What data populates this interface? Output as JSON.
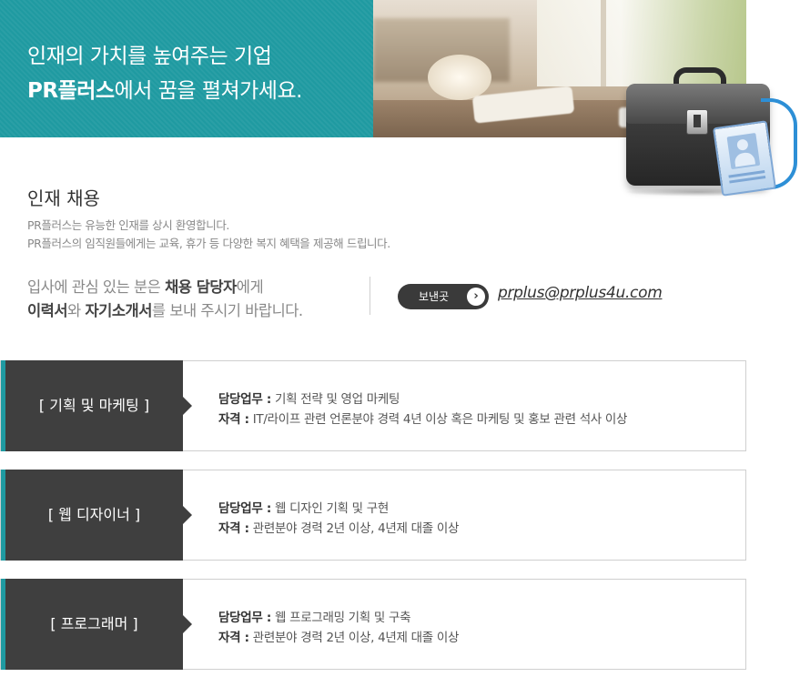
{
  "hero": {
    "line1": "인재의 가치를 높여주는 기업",
    "line2_brand": "PR플러스",
    "line2_rest": "에서 꿈을 펼쳐가세요."
  },
  "intro": {
    "title": "인재 채용",
    "desc1": "PR플러스는 유능한 인재를 상시 환영합니다.",
    "desc2": "PR플러스의 임직원들에게는 교육, 휴가 등 다양한 복지 혜택을 제공해 드립니다."
  },
  "apply": {
    "l1_pre": "입사에 관심 있는 분은 ",
    "l1_bold": "채용 담당자",
    "l1_post": "에게",
    "l2_bold1": "이력서",
    "l2_mid": "와 ",
    "l2_bold2": "자기소개서",
    "l2_post": "를 보내 주시기 바랍니다.",
    "send_label": "보낸곳",
    "send_icon": "chevron-right-icon",
    "email": "prplus@prplus4u.com"
  },
  "jobs": [
    {
      "title": "[ 기획 및 마케팅 ]",
      "duty_label": "담당업무 :",
      "duty": " 기획 전략 및 영업 마케팅",
      "qual_label": "자격 :",
      "qual": " IT/라이프 관련 언론분야 경력 4년 이상 혹은 마케팅 및 홍보 관련 석사 이상"
    },
    {
      "title": "[ 웹 디자이너 ]",
      "duty_label": "담당업무 :",
      "duty": " 웹 디자인 기획 및 구현",
      "qual_label": "자격 :",
      "qual": " 관련분야 경력 2년 이상, 4년제 대졸 이상"
    },
    {
      "title": "[ 프로그래머 ]",
      "duty_label": "담당업무 :",
      "duty": " 웹 프로그래밍 기획 및 구축",
      "qual_label": "자격 :",
      "qual": " 관련분야 경력 2년 이상, 4년제 대졸 이상"
    }
  ],
  "colors": {
    "accent": "#1f9aa1",
    "dark_label": "#3f3f3f",
    "send_button": "#3a3a3a"
  }
}
